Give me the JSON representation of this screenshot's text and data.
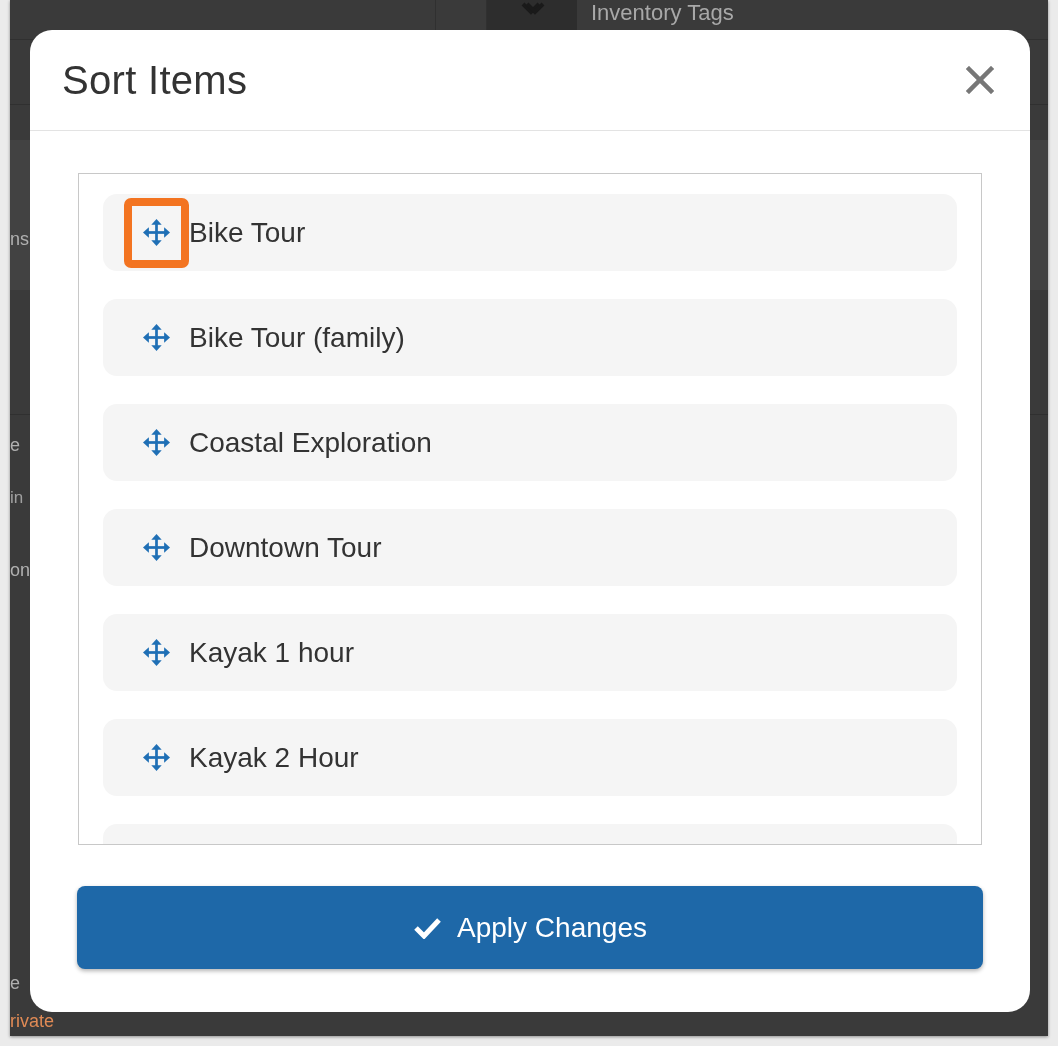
{
  "background_page": {
    "header_label": "Inventory Tags",
    "fragments": [
      {
        "text": "ns",
        "kind": "title"
      },
      {
        "text": "e",
        "kind": "title"
      },
      {
        "text": "in",
        "kind": "subtext"
      },
      {
        "text": "on",
        "kind": "title"
      },
      {
        "text": "e",
        "kind": "title"
      },
      {
        "text": "rivate",
        "kind": "status"
      }
    ]
  },
  "dialog": {
    "title": "Sort Items"
  },
  "sort_list": {
    "items": [
      {
        "label": "Bike Tour",
        "highlighted": true
      },
      {
        "label": "Bike Tour (family)",
        "highlighted": false
      },
      {
        "label": "Coastal Exploration",
        "highlighted": false
      },
      {
        "label": "Downtown Tour",
        "highlighted": false
      },
      {
        "label": "Kayak 1 hour",
        "highlighted": false
      },
      {
        "label": "Kayak 2 Hour",
        "highlighted": false
      }
    ],
    "more_below": true
  },
  "apply_button": {
    "label": "Apply Changes"
  }
}
